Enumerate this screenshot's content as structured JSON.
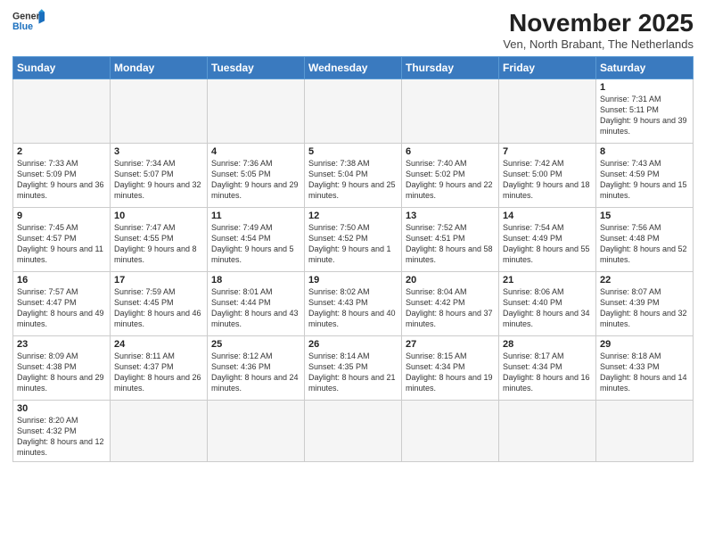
{
  "header": {
    "logo_general": "General",
    "logo_blue": "Blue",
    "title": "November 2025",
    "subtitle": "Ven, North Brabant, The Netherlands"
  },
  "weekdays": [
    "Sunday",
    "Monday",
    "Tuesday",
    "Wednesday",
    "Thursday",
    "Friday",
    "Saturday"
  ],
  "weeks": [
    [
      {
        "day": "",
        "info": ""
      },
      {
        "day": "",
        "info": ""
      },
      {
        "day": "",
        "info": ""
      },
      {
        "day": "",
        "info": ""
      },
      {
        "day": "",
        "info": ""
      },
      {
        "day": "",
        "info": ""
      },
      {
        "day": "1",
        "info": "Sunrise: 7:31 AM\nSunset: 5:11 PM\nDaylight: 9 hours and 39 minutes."
      }
    ],
    [
      {
        "day": "2",
        "info": "Sunrise: 7:33 AM\nSunset: 5:09 PM\nDaylight: 9 hours and 36 minutes."
      },
      {
        "day": "3",
        "info": "Sunrise: 7:34 AM\nSunset: 5:07 PM\nDaylight: 9 hours and 32 minutes."
      },
      {
        "day": "4",
        "info": "Sunrise: 7:36 AM\nSunset: 5:05 PM\nDaylight: 9 hours and 29 minutes."
      },
      {
        "day": "5",
        "info": "Sunrise: 7:38 AM\nSunset: 5:04 PM\nDaylight: 9 hours and 25 minutes."
      },
      {
        "day": "6",
        "info": "Sunrise: 7:40 AM\nSunset: 5:02 PM\nDaylight: 9 hours and 22 minutes."
      },
      {
        "day": "7",
        "info": "Sunrise: 7:42 AM\nSunset: 5:00 PM\nDaylight: 9 hours and 18 minutes."
      },
      {
        "day": "8",
        "info": "Sunrise: 7:43 AM\nSunset: 4:59 PM\nDaylight: 9 hours and 15 minutes."
      }
    ],
    [
      {
        "day": "9",
        "info": "Sunrise: 7:45 AM\nSunset: 4:57 PM\nDaylight: 9 hours and 11 minutes."
      },
      {
        "day": "10",
        "info": "Sunrise: 7:47 AM\nSunset: 4:55 PM\nDaylight: 9 hours and 8 minutes."
      },
      {
        "day": "11",
        "info": "Sunrise: 7:49 AM\nSunset: 4:54 PM\nDaylight: 9 hours and 5 minutes."
      },
      {
        "day": "12",
        "info": "Sunrise: 7:50 AM\nSunset: 4:52 PM\nDaylight: 9 hours and 1 minute."
      },
      {
        "day": "13",
        "info": "Sunrise: 7:52 AM\nSunset: 4:51 PM\nDaylight: 8 hours and 58 minutes."
      },
      {
        "day": "14",
        "info": "Sunrise: 7:54 AM\nSunset: 4:49 PM\nDaylight: 8 hours and 55 minutes."
      },
      {
        "day": "15",
        "info": "Sunrise: 7:56 AM\nSunset: 4:48 PM\nDaylight: 8 hours and 52 minutes."
      }
    ],
    [
      {
        "day": "16",
        "info": "Sunrise: 7:57 AM\nSunset: 4:47 PM\nDaylight: 8 hours and 49 minutes."
      },
      {
        "day": "17",
        "info": "Sunrise: 7:59 AM\nSunset: 4:45 PM\nDaylight: 8 hours and 46 minutes."
      },
      {
        "day": "18",
        "info": "Sunrise: 8:01 AM\nSunset: 4:44 PM\nDaylight: 8 hours and 43 minutes."
      },
      {
        "day": "19",
        "info": "Sunrise: 8:02 AM\nSunset: 4:43 PM\nDaylight: 8 hours and 40 minutes."
      },
      {
        "day": "20",
        "info": "Sunrise: 8:04 AM\nSunset: 4:42 PM\nDaylight: 8 hours and 37 minutes."
      },
      {
        "day": "21",
        "info": "Sunrise: 8:06 AM\nSunset: 4:40 PM\nDaylight: 8 hours and 34 minutes."
      },
      {
        "day": "22",
        "info": "Sunrise: 8:07 AM\nSunset: 4:39 PM\nDaylight: 8 hours and 32 minutes."
      }
    ],
    [
      {
        "day": "23",
        "info": "Sunrise: 8:09 AM\nSunset: 4:38 PM\nDaylight: 8 hours and 29 minutes."
      },
      {
        "day": "24",
        "info": "Sunrise: 8:11 AM\nSunset: 4:37 PM\nDaylight: 8 hours and 26 minutes."
      },
      {
        "day": "25",
        "info": "Sunrise: 8:12 AM\nSunset: 4:36 PM\nDaylight: 8 hours and 24 minutes."
      },
      {
        "day": "26",
        "info": "Sunrise: 8:14 AM\nSunset: 4:35 PM\nDaylight: 8 hours and 21 minutes."
      },
      {
        "day": "27",
        "info": "Sunrise: 8:15 AM\nSunset: 4:34 PM\nDaylight: 8 hours and 19 minutes."
      },
      {
        "day": "28",
        "info": "Sunrise: 8:17 AM\nSunset: 4:34 PM\nDaylight: 8 hours and 16 minutes."
      },
      {
        "day": "29",
        "info": "Sunrise: 8:18 AM\nSunset: 4:33 PM\nDaylight: 8 hours and 14 minutes."
      }
    ],
    [
      {
        "day": "30",
        "info": "Sunrise: 8:20 AM\nSunset: 4:32 PM\nDaylight: 8 hours and 12 minutes."
      },
      {
        "day": "",
        "info": ""
      },
      {
        "day": "",
        "info": ""
      },
      {
        "day": "",
        "info": ""
      },
      {
        "day": "",
        "info": ""
      },
      {
        "day": "",
        "info": ""
      },
      {
        "day": "",
        "info": ""
      }
    ]
  ]
}
